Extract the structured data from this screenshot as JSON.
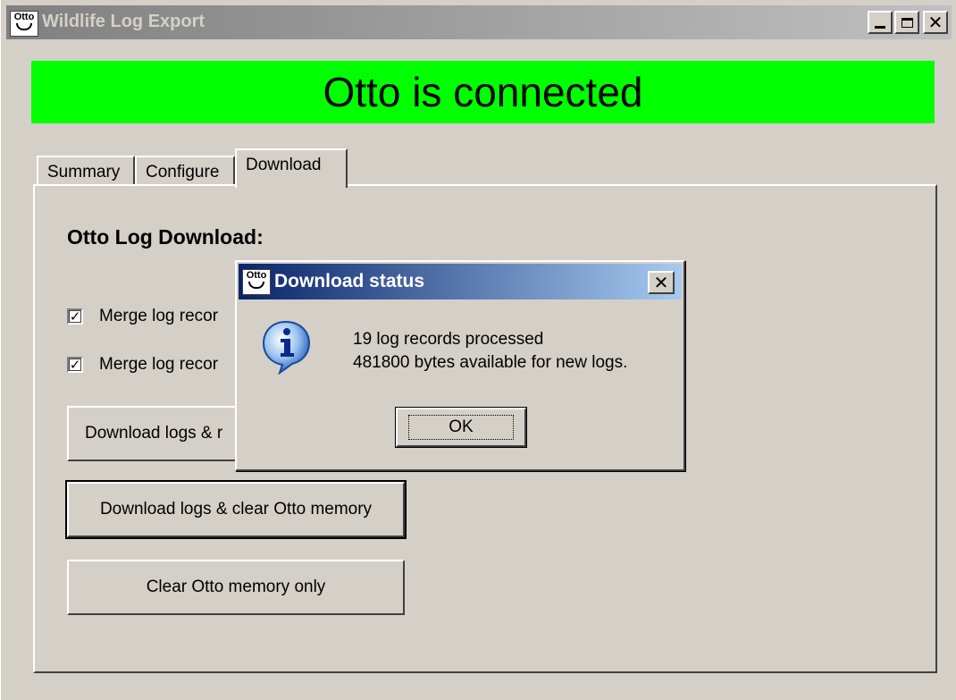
{
  "window": {
    "title": "Wildlife Log Export",
    "logo_text": "Otto",
    "controls": {
      "minimize": "minimize-icon",
      "maximize": "maximize-icon",
      "close": "close-icon"
    }
  },
  "status_banner": {
    "text": "Otto is connected",
    "color": "#00ff00"
  },
  "tabs": [
    {
      "label": "Summary",
      "active": false
    },
    {
      "label": "Configure",
      "active": false
    },
    {
      "label": "Download",
      "active": true
    }
  ],
  "download_panel": {
    "heading": "Otto Log Download:",
    "checkboxes": [
      {
        "label": "Merge log recor",
        "checked": true
      },
      {
        "label": "Merge log recor",
        "checked": true
      }
    ],
    "buttons": {
      "download_keep": "Download logs & r",
      "download_clear": "Download logs & clear Otto memory",
      "clear_only": "Clear Otto memory only"
    }
  },
  "dialog": {
    "title": "Download status",
    "logo_text": "Otto",
    "icon": "info-icon",
    "message_line1": "19 log records processed",
    "message_line2": "481800 bytes available for new logs.",
    "ok_label": "OK",
    "title_color": "#0a246a"
  }
}
